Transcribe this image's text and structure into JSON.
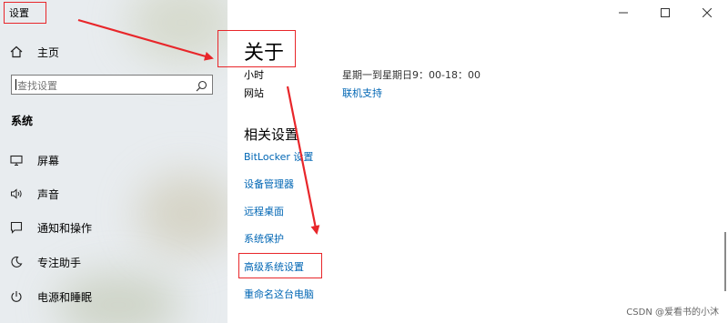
{
  "app_title": "设置",
  "sidebar": {
    "home": {
      "label": "主页",
      "icon": "home-icon"
    },
    "search": {
      "placeholder": "查找设置",
      "icon": "search-icon"
    },
    "section_title": "系统",
    "items": [
      {
        "label": "屏幕",
        "icon": "display-icon"
      },
      {
        "label": "声音",
        "icon": "sound-icon"
      },
      {
        "label": "通知和操作",
        "icon": "notification-icon"
      },
      {
        "label": "专注助手",
        "icon": "focus-assist-icon"
      },
      {
        "label": "电源和睡眠",
        "icon": "power-icon"
      }
    ]
  },
  "window_controls": [
    "minimize-icon",
    "maximize-icon",
    "close-icon"
  ],
  "main": {
    "title": "关于",
    "support": [
      {
        "label": "小时",
        "value": "星期一到星期日9：00-18：00"
      },
      {
        "label": "网站",
        "value": "联机支持"
      }
    ],
    "related_title": "相关设置",
    "related_links": [
      "BitLocker 设置",
      "设备管理器",
      "远程桌面",
      "系统保护",
      "高级系统设置",
      "重命名这台电脑"
    ]
  },
  "watermark": "CSDN @爱看书的小沐",
  "colors": {
    "link": "#0066b4",
    "annotation": "#e8262a",
    "sidebar_bg": "#e8ecef"
  }
}
